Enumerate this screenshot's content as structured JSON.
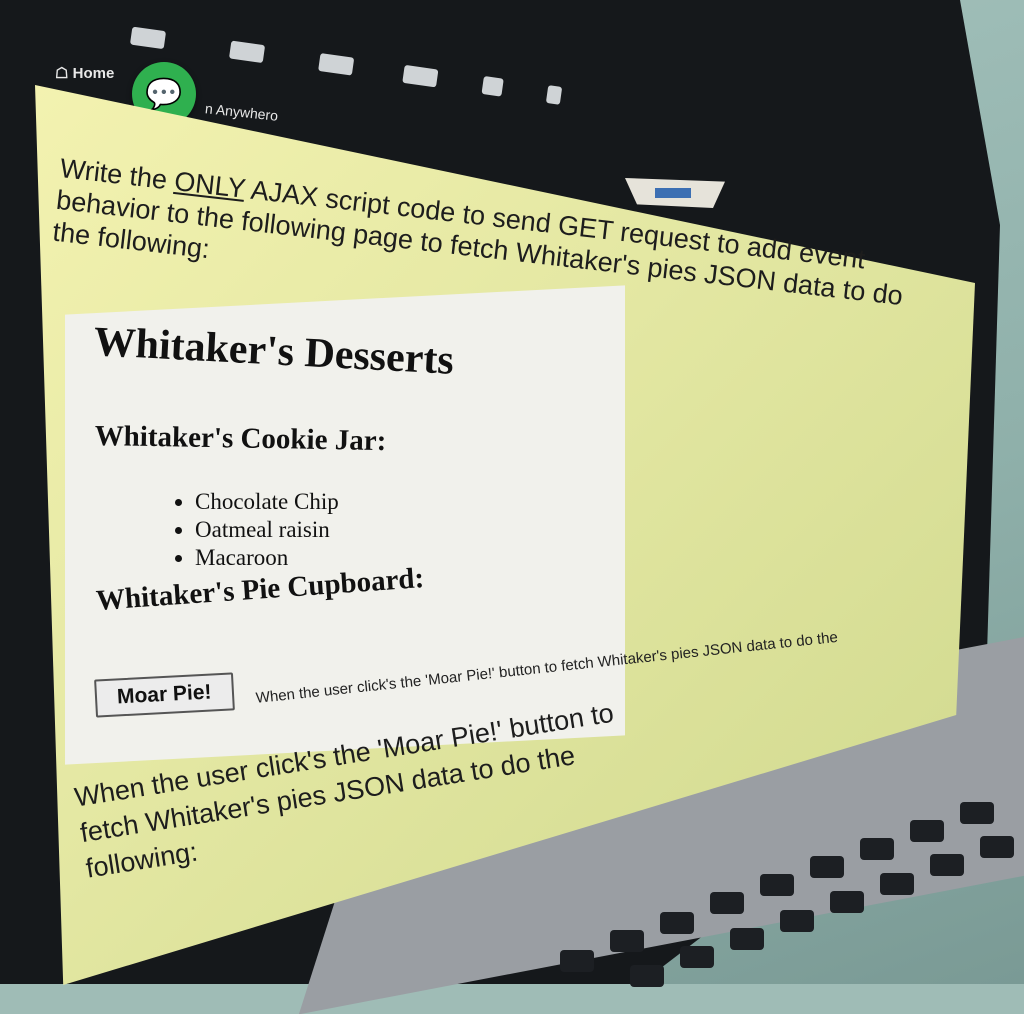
{
  "nav": {
    "home": "Home",
    "anywhere": "n Anywhero"
  },
  "slide": {
    "headline_pre": "Write the ",
    "headline_underlined": "ONLY",
    "headline_post": " AJAX script code to send GET request to add event behavior to the following page to fetch Whitaker's pies JSON data to do the following:",
    "page_title": "Whitaker's Desserts",
    "cookie_heading": "Whitaker's Cookie Jar:",
    "cookies": [
      "Chocolate Chip",
      "Oatmeal raisin",
      "Macaroon"
    ],
    "pie_heading": "Whitaker's Pie Cupboard:",
    "moar_button": "Moar Pie!",
    "instruction": "When the user click's the 'Moar Pie!' button to fetch Whitaker's pies JSON data to do the",
    "footer": "When the user click's the 'Moar Pie!' button to fetch Whitaker's pies JSON data to do the following:"
  }
}
